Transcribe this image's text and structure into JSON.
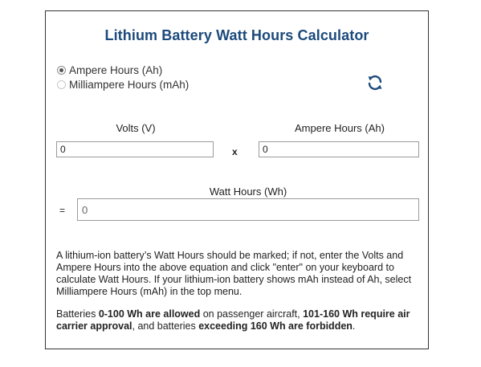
{
  "calculator": {
    "title": "Lithium Battery Watt Hours Calculator",
    "unit_options": [
      {
        "label": "Ampere Hours (Ah)",
        "selected": true
      },
      {
        "label": "Milliampere Hours (mAh)",
        "selected": false
      }
    ],
    "reset_icon": "refresh-icon",
    "volts_label": "Volts (V)",
    "volts_value": "0",
    "multiply_symbol": "x",
    "ampere_hours_label": "Ampere Hours (Ah)",
    "ampere_hours_value": "0",
    "watt_hours_label": "Watt Hours (Wh)",
    "equals_symbol": "=",
    "watt_hours_value": "0"
  },
  "info": {
    "paragraph1": "A lithium-ion battery’s Watt Hours should be marked; if not, enter the Volts and Ampere Hours into the above equation and click \"enter\" on your keyboard to calculate Watt Hours. If your lithium-ion battery shows mAh instead of Ah, select Milliampere Hours (mAh) in the top menu.",
    "p2_text1": "Batteries ",
    "p2_bold1": "0-100 Wh are allowed",
    "p2_text2": " on passenger aircraft, ",
    "p2_bold2": "101-160 Wh require air carrier approval",
    "p2_text3": ", and batteries ",
    "p2_bold3": "exceeding 160 Wh are forbidden",
    "p2_text4": "."
  },
  "colors": {
    "title": "#1c4a7c",
    "reset_icon": "#1c4a7c",
    "border": "#333333"
  }
}
